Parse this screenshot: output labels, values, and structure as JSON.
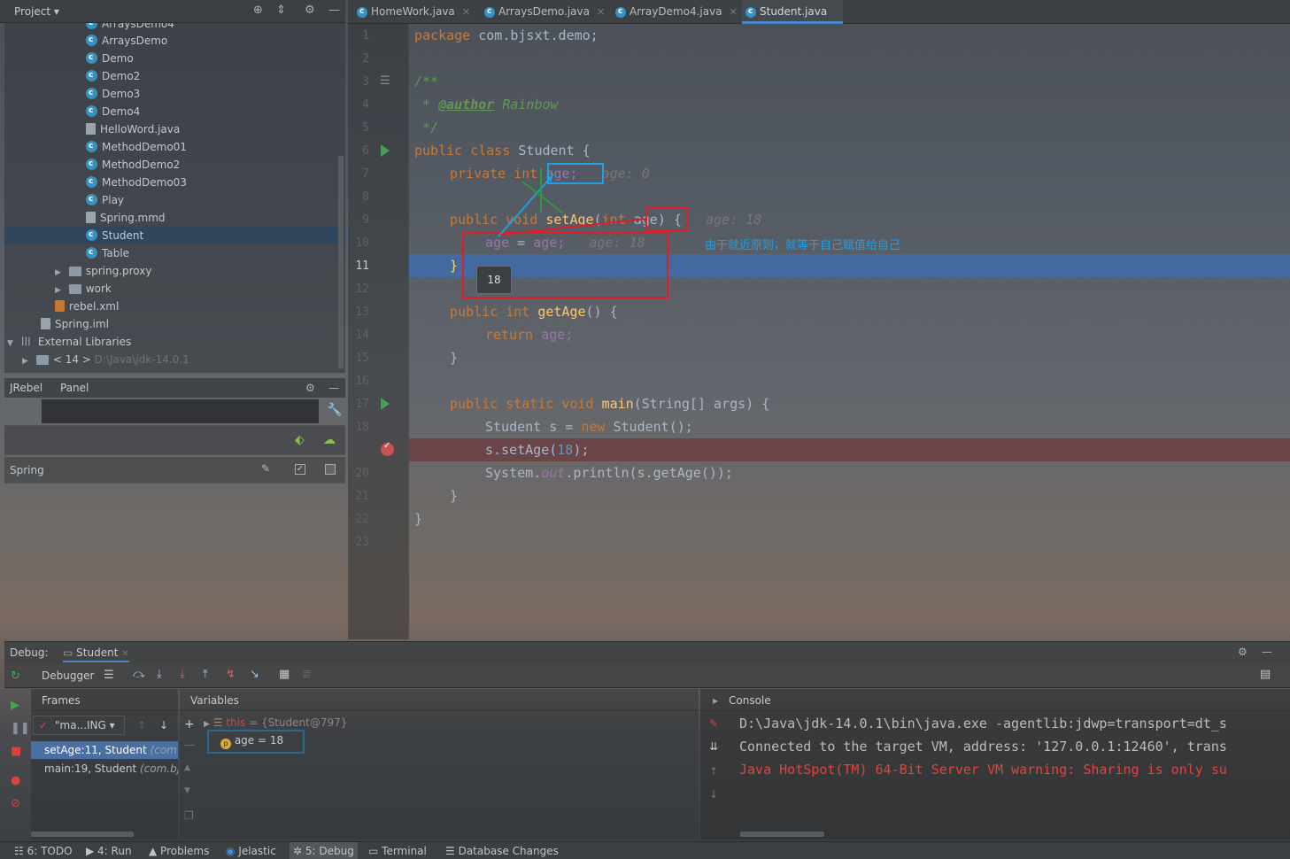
{
  "project": {
    "title": "Project",
    "tree": [
      {
        "label": "ArraysDemo4",
        "kind": "class"
      },
      {
        "label": "ArraysDemo",
        "kind": "class"
      },
      {
        "label": "Demo",
        "kind": "class"
      },
      {
        "label": "Demo2",
        "kind": "class"
      },
      {
        "label": "Demo3",
        "kind": "class"
      },
      {
        "label": "Demo4",
        "kind": "class"
      },
      {
        "label": "HelloWord.java",
        "kind": "file"
      },
      {
        "label": "MethodDemo01",
        "kind": "class"
      },
      {
        "label": "MethodDemo2",
        "kind": "class"
      },
      {
        "label": "MethodDemo03",
        "kind": "class"
      },
      {
        "label": "Play",
        "kind": "class"
      },
      {
        "label": "Spring.mmd",
        "kind": "file"
      },
      {
        "label": "Student",
        "kind": "class",
        "selected": true
      },
      {
        "label": "Table",
        "kind": "class"
      },
      {
        "label": "spring.proxy",
        "kind": "folder"
      },
      {
        "label": "work",
        "kind": "folder"
      },
      {
        "label": "rebel.xml",
        "kind": "file"
      },
      {
        "label": "Spring.iml",
        "kind": "file"
      },
      {
        "label": "External Libraries",
        "kind": "lib"
      },
      {
        "label": "< 14 >",
        "kind": "folder",
        "suffix": "D:\\Java\\jdk-14.0.1"
      }
    ]
  },
  "jrebel": {
    "tab1": "JRebel",
    "tab2": "Panel",
    "spring_label": "Spring"
  },
  "tabs": [
    {
      "label": "HomeWork.java",
      "active": false
    },
    {
      "label": "ArraysDemo.java",
      "active": false
    },
    {
      "label": "ArrayDemo4.java",
      "active": false
    },
    {
      "label": "Student.java",
      "active": true
    }
  ],
  "editor": {
    "line_numbers": [
      "1",
      "2",
      "3",
      "4",
      "5",
      "6",
      "7",
      "8",
      "9",
      "10",
      "11",
      "12",
      "13",
      "14",
      "15",
      "16",
      "17",
      "18",
      "19",
      "20",
      "21",
      "22",
      "23"
    ],
    "current_line": "11",
    "pkg_kw": "package",
    "pkg_name": "com.bjsxt.demo;",
    "doc_open": "/**",
    "doc_star": " * ",
    "doc_author": "@author",
    "doc_author_name": "Rainbow",
    "doc_close": " */",
    "l6_kw": "public class",
    "l6_name": "Student {",
    "l7_kw": "private int",
    "l7_field": "age;",
    "l7_hint": "age: 0",
    "l9_kw": "public void",
    "l9_fn": "setAge",
    "l9_p1": "(",
    "l9_kw2": "int",
    "l9_param": "age",
    "l9_p2": ") {",
    "l9_hint": "age: 18",
    "l10_field": "age",
    "l10_eq": " = ",
    "l10_val": "age;",
    "l10_hint": "age: 18",
    "l11": "}",
    "l13_kw": "public int",
    "l13_fn": "getAge",
    "l13_rest": "() {",
    "l14_kw": "return",
    "l14_field": "age;",
    "l15": "}",
    "l17_kw": "public static void",
    "l17_fn": "main",
    "l17_rest": "(String[] args) {",
    "l18_a": "Student s = ",
    "l18_kw": "new",
    "l18_b": " Student();",
    "l19_a": "s.setAge(",
    "l19_num": "18",
    "l19_b": ");",
    "l20_a": "System.",
    "l20_out": "out",
    "l20_b": ".println(s.getAge());",
    "l21": "}",
    "l22": "}",
    "annotation_note": "由于就近原则，就等于自己赋值给自己",
    "tooltip_value": "18"
  },
  "debug": {
    "label": "Debug:",
    "tab": "Student",
    "debugger": "Debugger",
    "frames_title": "Frames",
    "variables_title": "Variables",
    "console_title": "Console",
    "thread": "\"ma...ING",
    "frames": [
      {
        "method": "setAge:11, Student",
        "pkg": "(com.b",
        "selected": true
      },
      {
        "method": "main:19, Student",
        "pkg": "(com.bjs",
        "selected": false
      }
    ],
    "var_this": "this",
    "var_this_value": "= {Student@797}",
    "var_age": "age = 18",
    "console_lines": [
      {
        "text": "D:\\Java\\jdk-14.0.1\\bin\\java.exe -agentlib:jdwp=transport=dt_s",
        "color": "#bbbbbb"
      },
      {
        "text": "Connected to the target VM, address: '127.0.0.1:12460', trans",
        "color": "#bbbbbb"
      },
      {
        "text": "Java HotSpot(TM) 64-Bit Server VM warning: Sharing is only su",
        "color": "#e0443e"
      }
    ]
  },
  "bottom_tabs": [
    {
      "label": "6: TODO",
      "icon": "todo-icon"
    },
    {
      "label": "4: Run",
      "icon": "run-icon"
    },
    {
      "label": "Problems",
      "icon": "warning-icon"
    },
    {
      "label": "Jelastic",
      "icon": "jelastic-icon"
    },
    {
      "label": "5: Debug",
      "icon": "debug-icon",
      "active": true
    },
    {
      "label": "Terminal",
      "icon": "terminal-icon"
    },
    {
      "label": "Database Changes",
      "icon": "database-icon"
    }
  ],
  "colors": {
    "accent_blue": "#1e9fe6",
    "annotation_red": "#d9202a",
    "exec_line": "#3c6eb4",
    "breakpoint": "#c75450"
  }
}
